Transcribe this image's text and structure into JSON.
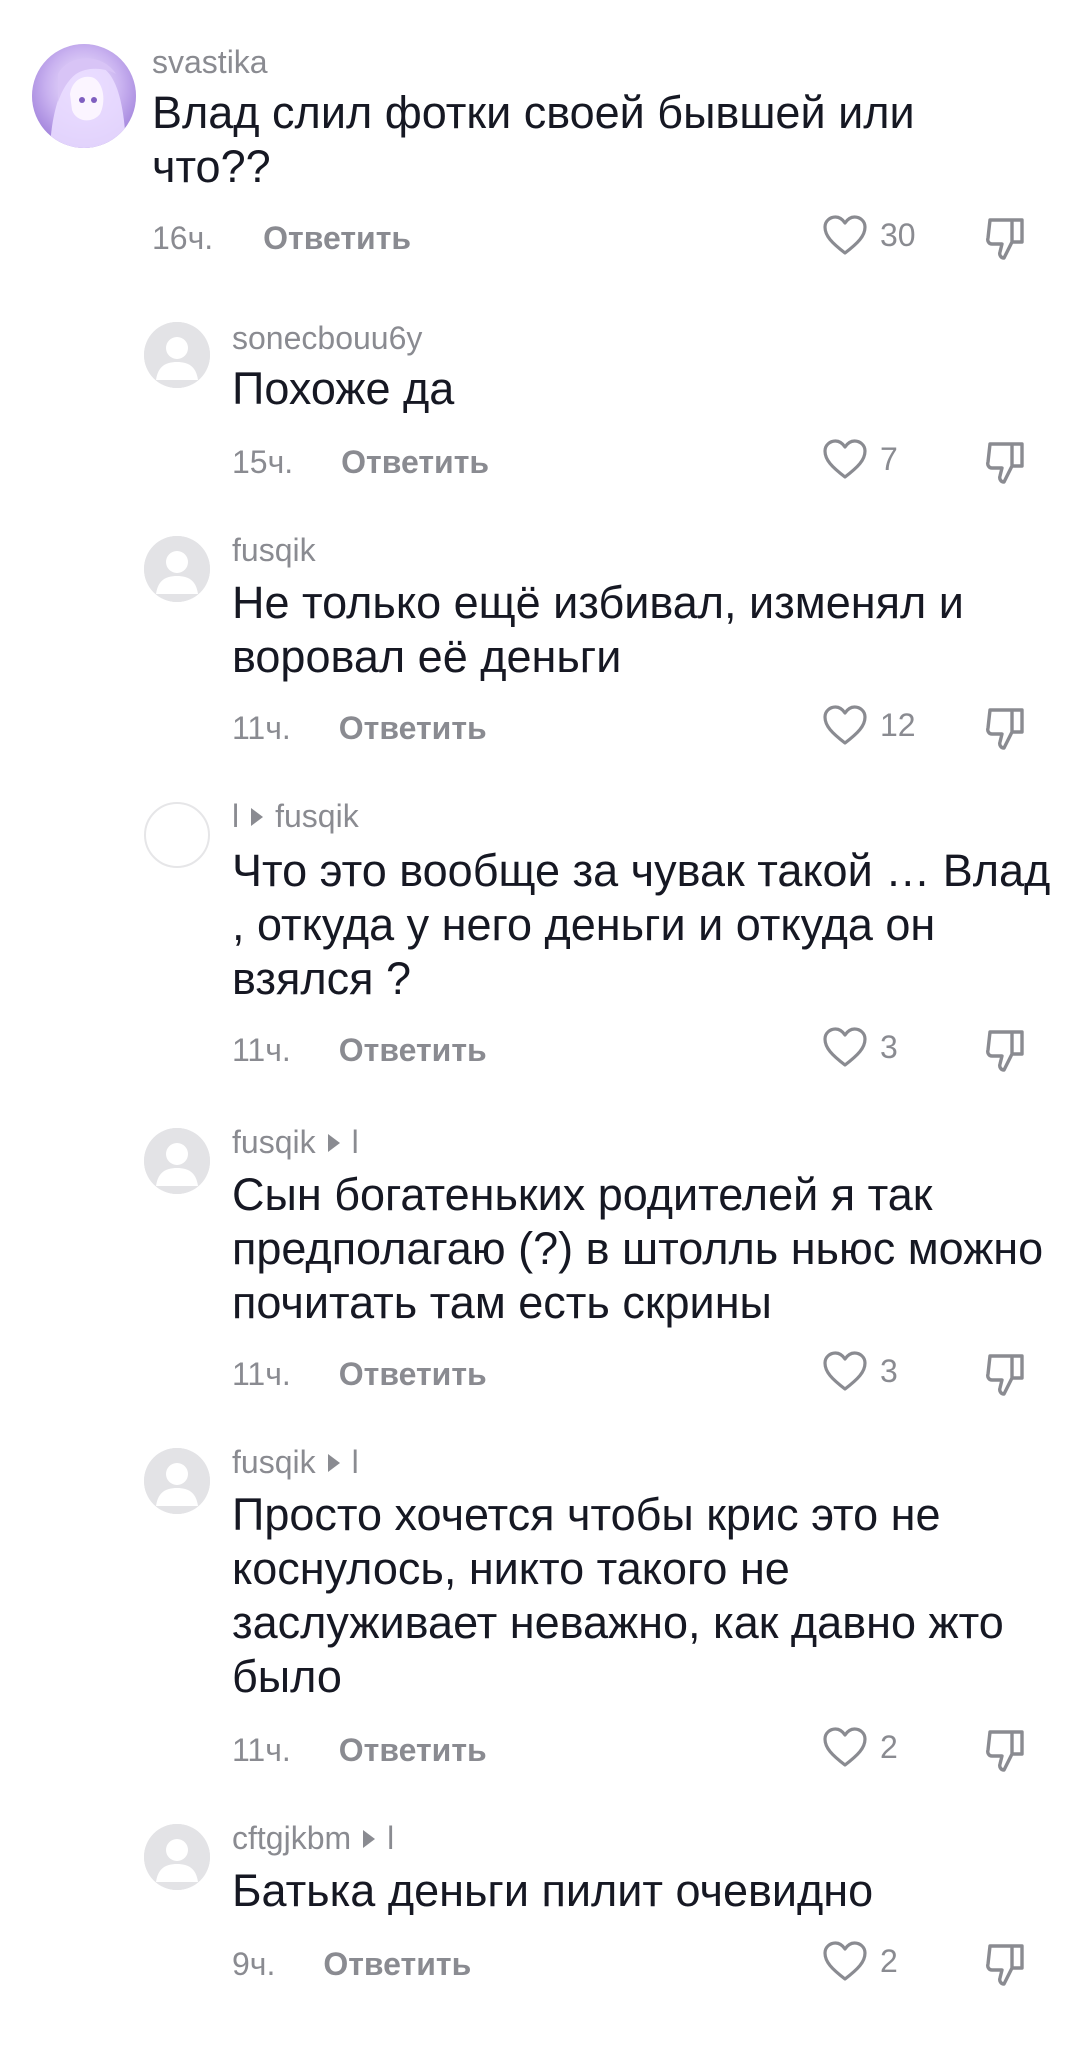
{
  "comments": [
    {
      "username": "svastika",
      "reply_to": null,
      "text": "Влад слил фотки своей бывшей или что??",
      "time": "16ч.",
      "likes": "30",
      "avatar": "anime"
    },
    {
      "username": "sonecbouu6y",
      "reply_to": null,
      "text": "Похоже да",
      "time": "15ч.",
      "likes": "7",
      "avatar": "default"
    },
    {
      "username": "fusqik",
      "reply_to": null,
      "text": "Не только ещё избивал, изменял и воровал её деньги",
      "time": "11ч.",
      "likes": "12",
      "avatar": "default"
    },
    {
      "username": "l",
      "reply_to": "fusqik",
      "text": "Что это вообще за чувак такой … Влад , откуда у него деньги и откуда он взялся ?",
      "time": "11ч.",
      "likes": "3",
      "avatar": "blank"
    },
    {
      "username": "fusqik",
      "reply_to": "l",
      "text": "Сын богатеньких родителей я так предполагаю (?) в штолль ньюс можно почитать там есть скрины",
      "time": "11ч.",
      "likes": "3",
      "avatar": "default"
    },
    {
      "username": "fusqik",
      "reply_to": "l",
      "text": "Просто хочется чтобы крис это не коснулось, никто такого не заслуживает неважно, как давно жто было",
      "time": "11ч.",
      "likes": "2",
      "avatar": "default"
    },
    {
      "username": "cftgjkbm",
      "reply_to": "l",
      "text": "Батька деньги пилит очевидно",
      "time": "9ч.",
      "likes": "2",
      "avatar": "default"
    }
  ],
  "reply_label": "Ответить",
  "colors": {
    "text": "#161823",
    "secondary": "#8a8b91",
    "avatar_default": "#e3e3e6"
  }
}
